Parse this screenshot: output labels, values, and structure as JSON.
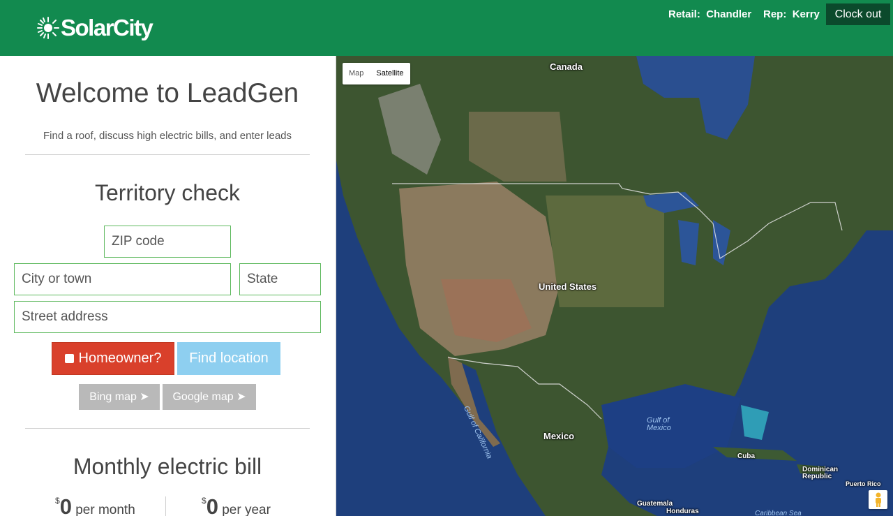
{
  "header": {
    "logo_text": "SolarCity",
    "retail_label": "Retail:",
    "retail_value": "Chandler",
    "rep_label": "Rep:",
    "rep_value": "Kerry",
    "clock_out_label": "Clock out",
    "brand_color": "#128a4f"
  },
  "left": {
    "welcome_title": "Welcome to LeadGen",
    "tagline": "Find a roof, discuss high electric bills, and enter leads",
    "territory_title": "Territory check",
    "zip_placeholder": "ZIP code",
    "city_placeholder": "City or town",
    "state_placeholder": "State",
    "street_placeholder": "Street address",
    "homeowner_label": "Homeowner?",
    "find_location_label": "Find location",
    "bing_map_label": "Bing map ➤",
    "google_map_label": "Google map ➤",
    "bill_title": "Monthly electric bill",
    "bill_currency": "$",
    "per_month_value": "0",
    "per_month_label": "per month",
    "per_year_value": "0",
    "per_year_label": "per year"
  },
  "map": {
    "toggle_map": "Map",
    "toggle_satellite": "Satellite",
    "labels": {
      "canada": "Canada",
      "united_states": "United States",
      "mexico": "Mexico",
      "gulf_of_california": "Gulf of California",
      "gulf_of_mexico_1": "Gulf of",
      "gulf_of_mexico_2": "Mexico",
      "cuba": "Cuba",
      "dominican_1": "Dominican",
      "dominican_2": "Republic",
      "puerto_rico": "Puerto Rico",
      "guatemala": "Guatemala",
      "honduras": "Honduras",
      "caribbean_sea": "Caribbean Sea"
    },
    "pegman_icon": "pegman-icon"
  }
}
